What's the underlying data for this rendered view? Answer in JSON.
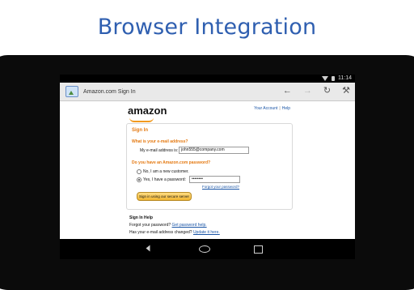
{
  "headline": "Browser Integration",
  "status": {
    "time": "11:14"
  },
  "browser": {
    "tab_title": "Amazon.com Sign In",
    "icons": [
      "back-arrow-icon",
      "forward-arrow-icon",
      "refresh-icon",
      "wrench-icon"
    ]
  },
  "page": {
    "logo": "amazon",
    "top_links": [
      "Your Account",
      "Help"
    ],
    "sign_in": {
      "title": "Sign In",
      "email_question": "What is your e-mail address?",
      "email_label": "My e-mail address is:",
      "email_value": "john555@company.com",
      "password_question": "Do you have an Amazon.com password?",
      "option_new": "No, I am a new customer.",
      "option_existing": "Yes, I have a password:",
      "password_value": "••••••••",
      "forgot_link": "Forgot your password?",
      "submit": "Sign in using our secure server"
    },
    "help": {
      "title": "Sign In Help",
      "forgot_text": "Forgot your password?",
      "forgot_link": "Get password help.",
      "changed_text": "Has your e-mail address changed?",
      "changed_link": "Update it here."
    }
  },
  "colors": {
    "headline": "#2f5fb0",
    "amazon_orange": "#e47911",
    "link_blue": "#1a55a6"
  }
}
